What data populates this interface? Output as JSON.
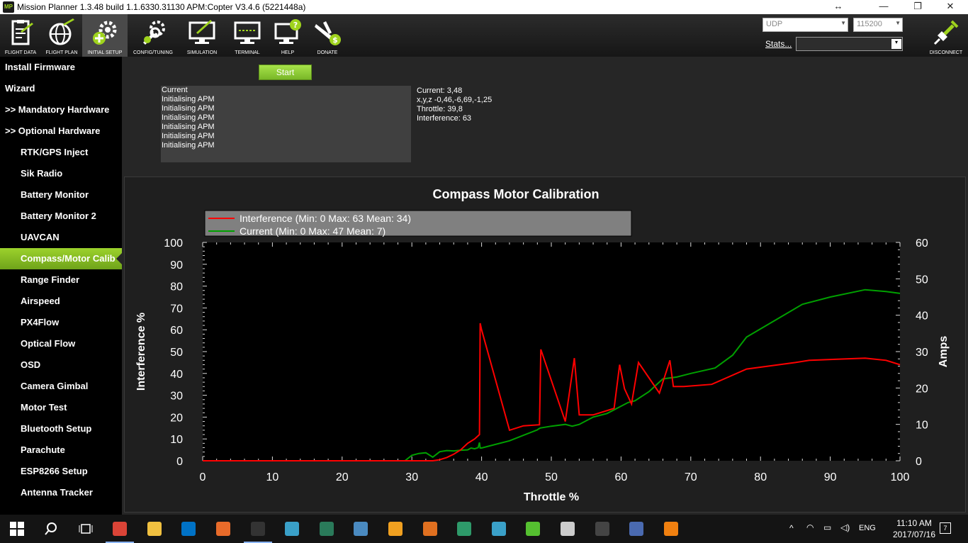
{
  "window": {
    "title": "Mission Planner 1.3.48 build 1.1.6330.31130 APM:Copter V3.4.6 (5221448a)",
    "app_icon_text": "MP",
    "resize_glyph": "↔",
    "minimize_glyph": "—",
    "maximize_glyph": "❐",
    "close_glyph": "✕"
  },
  "toolbar": {
    "buttons": [
      {
        "label": "FLIGHT DATA",
        "icon": "clipboard-plane-icon"
      },
      {
        "label": "FLIGHT PLAN",
        "icon": "globe-plane-icon"
      },
      {
        "label": "INITIAL SETUP",
        "icon": "gears-plus-icon"
      },
      {
        "label": "CONFIG/TUNING",
        "icon": "wrench-gear-icon"
      },
      {
        "label": "SIMULATION",
        "icon": "monitor-plane-icon"
      },
      {
        "label": "TERMINAL",
        "icon": "terminal-icon"
      },
      {
        "label": "HELP",
        "icon": "monitor-question-icon"
      },
      {
        "label": "DONATE",
        "icon": "plane-dollar-icon"
      }
    ],
    "connection_type": "UDP",
    "baud_rate": "115200",
    "stats_label": "Stats...",
    "stats_value": "",
    "disconnect_label": "DISCONNECT"
  },
  "sidebar": {
    "items": [
      {
        "label": "Install Firmware",
        "indent": false
      },
      {
        "label": "Wizard",
        "indent": false
      },
      {
        "label": ">> Mandatory Hardware",
        "indent": false
      },
      {
        "label": ">> Optional Hardware",
        "indent": false
      },
      {
        "label": "RTK/GPS Inject",
        "indent": true
      },
      {
        "label": "Sik Radio",
        "indent": true
      },
      {
        "label": "Battery Monitor",
        "indent": true
      },
      {
        "label": "Battery Monitor 2",
        "indent": true
      },
      {
        "label": "UAVCAN",
        "indent": true
      },
      {
        "label": "Compass/Motor Calib",
        "indent": true,
        "active": true
      },
      {
        "label": "Range Finder",
        "indent": true
      },
      {
        "label": "Airspeed",
        "indent": true
      },
      {
        "label": "PX4Flow",
        "indent": true
      },
      {
        "label": "Optical Flow",
        "indent": true
      },
      {
        "label": "OSD",
        "indent": true
      },
      {
        "label": "Camera Gimbal",
        "indent": true
      },
      {
        "label": "Motor Test",
        "indent": true
      },
      {
        "label": "Bluetooth Setup",
        "indent": true
      },
      {
        "label": "Parachute",
        "indent": true
      },
      {
        "label": "ESP8266 Setup",
        "indent": true
      },
      {
        "label": "Antenna Tracker",
        "indent": true
      }
    ]
  },
  "main": {
    "start_button": "Start",
    "log_lines": [
      "Current",
      "Initialising APM",
      "Initialising APM",
      "Initialising APM",
      "Initialising APM",
      "Initialising APM",
      "Initialising APM"
    ],
    "readout": {
      "current": "Current: 3,48",
      "xyz": "x,y,z -0,46,-6,69,-1,25",
      "throttle": "Throttle: 39,8",
      "interference": "Interference: 63"
    }
  },
  "chart_data": {
    "type": "line",
    "title": "Compass Motor Calibration",
    "xlabel": "Throttle %",
    "ylabel": "Interference %",
    "y2label": "Amps",
    "xlim": [
      0,
      100
    ],
    "ylim": [
      0,
      100
    ],
    "y2lim": [
      0,
      60
    ],
    "xticks": [
      0,
      10,
      20,
      30,
      40,
      50,
      60,
      70,
      80,
      90,
      100
    ],
    "yticks": [
      0,
      10,
      20,
      30,
      40,
      50,
      60,
      70,
      80,
      90,
      100
    ],
    "y2ticks": [
      0,
      10,
      20,
      30,
      40,
      50,
      60
    ],
    "legend_position": "top-left",
    "background": "#000000",
    "series": [
      {
        "name": "Interference (Min: 0 Max: 63 Mean: 34)",
        "color": "#ff0000",
        "axis": "left",
        "x": [
          0,
          33,
          34,
          35,
          36,
          37,
          38,
          39,
          39.7,
          39.8,
          40,
          44,
          46,
          48.3,
          48.5,
          52,
          53.3,
          54,
          56,
          59,
          59.8,
          60.5,
          61.5,
          62.5,
          64,
          65.5,
          67,
          67.5,
          69,
          73,
          78,
          85,
          87,
          91,
          95,
          98,
          100
        ],
        "y": [
          0,
          0,
          0.5,
          1.5,
          3,
          5,
          8,
          10,
          12,
          63,
          60,
          14,
          16,
          16.5,
          51,
          18,
          47,
          21,
          21,
          24,
          44,
          33,
          26,
          45,
          38,
          31,
          46,
          34,
          34,
          35,
          42,
          45,
          46,
          46.5,
          47,
          46,
          44
        ]
      },
      {
        "name": "Current (Min: 0 Max: 47 Mean: 7)",
        "color": "#00a000",
        "axis": "right",
        "x": [
          0,
          29,
          30,
          31,
          32,
          33,
          34,
          35,
          36,
          37,
          38,
          38.5,
          39,
          39.5,
          39.7,
          39.8,
          40,
          42,
          44,
          46,
          48,
          48.2,
          48.4,
          50,
          52,
          53,
          54,
          56,
          58,
          60,
          61,
          62,
          64,
          66,
          68,
          70,
          73.5,
          76,
          78,
          82,
          86,
          90,
          95,
          98,
          100
        ],
        "y": [
          0,
          0,
          1.5,
          2,
          2.2,
          1,
          2.5,
          2.8,
          2.7,
          2.9,
          3,
          3.5,
          3.3,
          3.6,
          5,
          3.5,
          3.5,
          4.5,
          5.5,
          7,
          8.5,
          8.8,
          9,
          9.5,
          10,
          9.5,
          10,
          12,
          13,
          15,
          16,
          16.5,
          19,
          22.5,
          23,
          24,
          25.5,
          29,
          34,
          38.5,
          43,
          45,
          47,
          46.5,
          46
        ]
      }
    ]
  },
  "taskbar": {
    "apps": [
      "start",
      "search",
      "task-view",
      "chrome",
      "file-explorer",
      "outlook",
      "matlab",
      "mission-planner",
      "app-2",
      "app-3",
      "app-4",
      "sublime-text",
      "app-5",
      "app-6",
      "app-7",
      "app-8",
      "calculator",
      "terminal",
      "network-app",
      "vlc"
    ],
    "language": "ENG",
    "time": "11:10 AM",
    "date": "2017/07/16",
    "notification_count": "7"
  }
}
